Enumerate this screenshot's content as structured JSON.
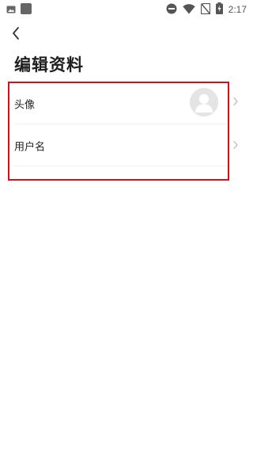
{
  "status_bar": {
    "time": "2:17",
    "left_icons": [
      "image-icon",
      "app-square-icon"
    ],
    "right_icons": [
      "do-not-disturb-icon",
      "wifi-icon",
      "no-sim-icon",
      "battery-charging-icon"
    ]
  },
  "header": {
    "back_icon": "chevron-left-icon",
    "title": "编辑资料"
  },
  "list": {
    "items": [
      {
        "label": "头像",
        "type": "avatar",
        "avatar_icon": "default-avatar-icon"
      },
      {
        "label": "用户名",
        "type": "text"
      }
    ],
    "chevron_icon": "chevron-right-icon",
    "highlight_color": "#d0101a"
  }
}
